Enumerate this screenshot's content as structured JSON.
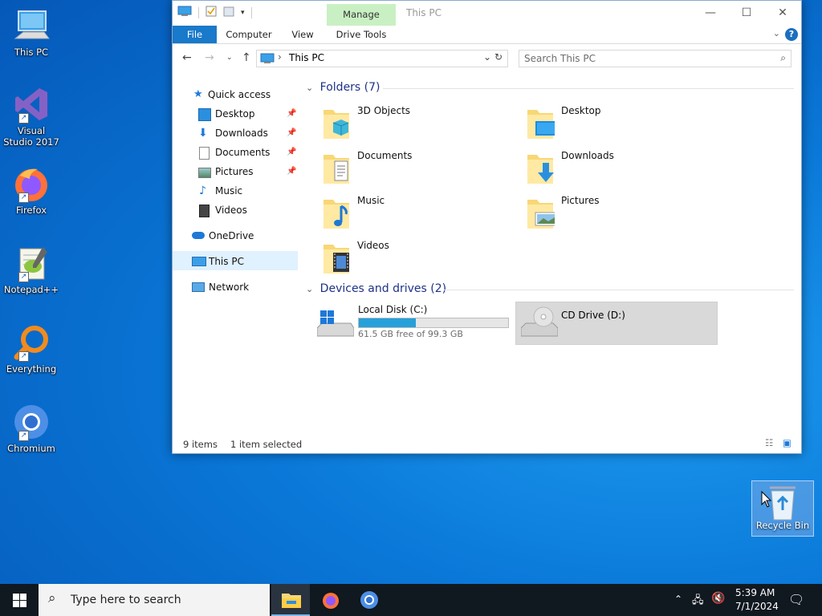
{
  "desktop": {
    "icons": [
      {
        "label": "This PC"
      },
      {
        "label": "Visual Studio 2017"
      },
      {
        "label": "Firefox"
      },
      {
        "label": "Notepad++"
      },
      {
        "label": "Everything"
      },
      {
        "label": "Chromium"
      }
    ],
    "recycle_bin": "Recycle Bin"
  },
  "explorer": {
    "title": "This PC",
    "manage_tab": "Manage",
    "ribbon_tabs": [
      "File",
      "Computer",
      "View",
      "Drive Tools"
    ],
    "address": "This PC",
    "search_placeholder": "Search This PC",
    "nav": {
      "quick_access": "Quick access",
      "quick_items": [
        "Desktop",
        "Downloads",
        "Documents",
        "Pictures",
        "Music",
        "Videos"
      ],
      "onedrive": "OneDrive",
      "this_pc": "This PC",
      "network": "Network"
    },
    "folders_header": "Folders (7)",
    "folders": [
      "3D Objects",
      "Desktop",
      "Documents",
      "Downloads",
      "Music",
      "Pictures",
      "Videos"
    ],
    "devices_header": "Devices and drives (2)",
    "drives": {
      "c": {
        "label": "Local Disk (C:)",
        "free_text": "61.5 GB free of 99.3 GB",
        "used_fraction": 0.38
      },
      "d": {
        "label": "CD Drive (D:)"
      }
    },
    "status": {
      "items": "9 items",
      "selected": "1 item selected"
    }
  },
  "taskbar": {
    "search_placeholder": "Type here to search",
    "time": "5:39 AM",
    "date": "7/1/2024"
  },
  "colors": {
    "accent": "#1979ca",
    "progress": "#26a0da",
    "manage_tab": "#c9f0c2"
  }
}
